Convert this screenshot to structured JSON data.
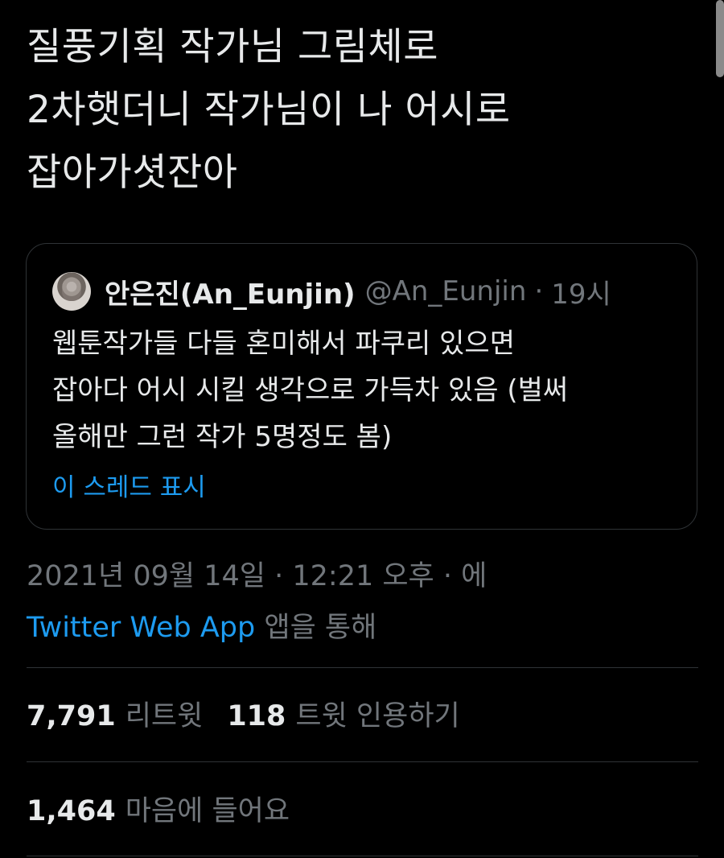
{
  "tweet": {
    "text_lines": [
      "질풍기획 작가님 그림체로",
      "2차햇더니 작가님이 나 어시로",
      "잡아가셧잔아"
    ]
  },
  "quote": {
    "display_name": "안은진(An_Eunjin)",
    "handle": "@An_Eunjin",
    "separator": "·",
    "time": "19시",
    "body_lines": [
      "웹툰작가들 다들 혼미해서 파쿠리 있으면",
      "잡아다 어시 시킬 생각으로 가득차 있음 (벌써",
      "올해만 그런 작가 5명정도 봄)"
    ],
    "show_thread": "이 스레드 표시"
  },
  "meta": {
    "timestamp_line": "2021년 09월 14일 · 12:21 오후 · 에",
    "app_name": "Twitter Web App",
    "app_suffix": " 앱을 통해"
  },
  "stats": {
    "retweets_count": "7,791",
    "retweets_label": "리트윗",
    "quotes_count": "118",
    "quotes_label": "트윗 인용하기",
    "likes_count": "1,464",
    "likes_label": "마음에 들어요"
  },
  "colors": {
    "background": "#000000",
    "text": "#e7e9ea",
    "secondary_text": "#71767b",
    "accent": "#1d9bf0",
    "border": "#2f3336"
  }
}
